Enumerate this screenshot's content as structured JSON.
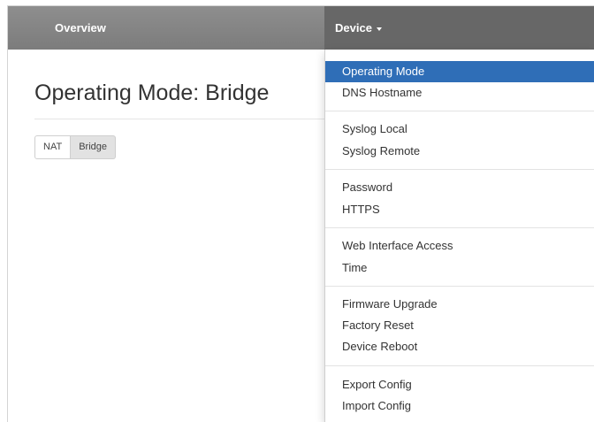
{
  "navbar": {
    "overview_label": "Overview",
    "device_label": "Device"
  },
  "page": {
    "title": "Operating Mode: Bridge"
  },
  "mode_buttons": {
    "nat_label": "NAT",
    "bridge_label": "Bridge",
    "selected": "Bridge"
  },
  "device_menu": {
    "groups": [
      {
        "items": [
          "Operating Mode",
          "DNS Hostname"
        ]
      },
      {
        "items": [
          "Syslog Local",
          "Syslog Remote"
        ]
      },
      {
        "items": [
          "Password",
          "HTTPS"
        ]
      },
      {
        "items": [
          "Web Interface Access",
          "Time"
        ]
      },
      {
        "items": [
          "Firmware Upgrade",
          "Factory Reset",
          "Device Reboot"
        ]
      },
      {
        "items": [
          "Export Config",
          "Import Config"
        ]
      }
    ],
    "active_item": "Operating Mode"
  },
  "colors": {
    "navbar": "#838383",
    "navbar_active": "#676767",
    "menu_highlight": "#2f6eb7"
  }
}
